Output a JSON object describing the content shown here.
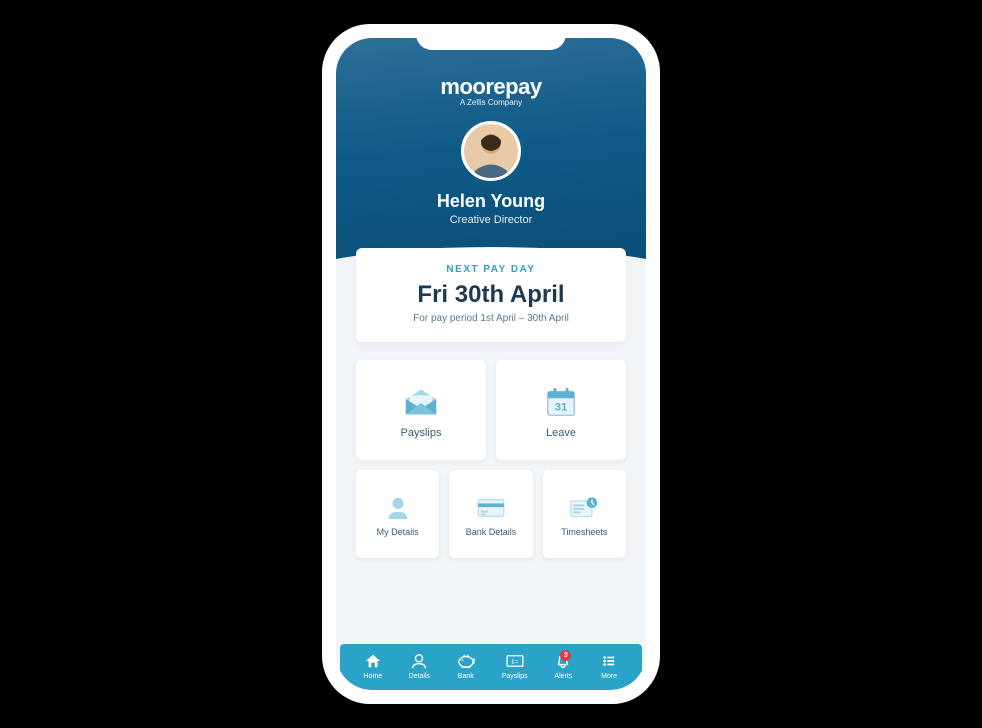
{
  "brand": {
    "name": "moorepay",
    "tagline": "A Zellis Company"
  },
  "user": {
    "name": "Helen Young",
    "role": "Creative Director"
  },
  "payday": {
    "label": "NEXT PAY DAY",
    "date": "Fri 30th April",
    "period": "For pay period 1st April – 30th April"
  },
  "tiles": {
    "payslips": "Payslips",
    "leave": "Leave",
    "leave_day": "31",
    "mydetails": "My Details",
    "bankdetails": "Bank Details",
    "timesheets": "Timesheets"
  },
  "nav": {
    "home": "Home",
    "details": "Details",
    "bank": "Bank",
    "payslips": "Payslips",
    "alerts": "Alerts",
    "alerts_badge": "3",
    "more": "More"
  }
}
